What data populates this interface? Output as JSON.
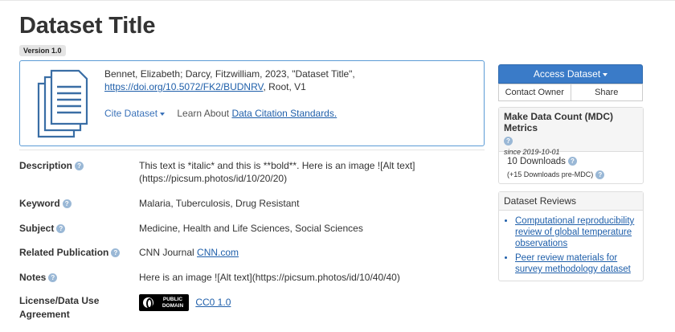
{
  "dataset": {
    "title": "Dataset Title",
    "version": "Version 1.0"
  },
  "citation": {
    "text": "Bennet, Elizabeth; Darcy, Fitzwilliam, 2023, \"Dataset Title\",",
    "doi": "https://doi.org/10.5072/FK2/BUDNRV",
    "suffix": ", Root, V1",
    "cite_label": "Cite Dataset",
    "learn_label": "Learn About",
    "standards_link": "Data Citation Standards."
  },
  "metadata": {
    "description_label": "Description",
    "description_value": "This text is *italic* and this is **bold**. Here is an image ![Alt text](https://picsum.photos/id/10/20/20)",
    "keyword_label": "Keyword",
    "keyword_value": "Malaria, Tuberculosis, Drug Resistant",
    "subject_label": "Subject",
    "subject_value": "Medicine, Health and Life Sciences, Social Sciences",
    "related_label": "Related Publication",
    "related_text": "CNN Journal",
    "related_link": "CNN.com",
    "notes_label": "Notes",
    "notes_value": "Here is an image ![Alt text](https://picsum.photos/id/10/40/40)",
    "license_label_1": "License/Data Use",
    "license_label_2": "Agreement",
    "license_badge_1": "PUBLIC",
    "license_badge_2": "DOMAIN",
    "license_link": "CC0 1.0"
  },
  "sidebar": {
    "access_label": "Access Dataset",
    "contact_label": "Contact Owner",
    "share_label": "Share",
    "mdc_title": "Make Data Count (MDC) Metrics",
    "mdc_since": "since 2019-10-01",
    "downloads": "10 Downloads",
    "downloads_pre": "(+15 Downloads pre-MDC)",
    "reviews_title": "Dataset Reviews",
    "review_1": "Computational reproducibility review of global temperature observations",
    "review_2": "Peer review materials for survey methodology dataset"
  },
  "help_glyph": "?",
  "colors": {
    "accent": "#3a7bc8",
    "link": "#1f5faa",
    "box_border": "#5b9bd5"
  },
  "icons": {
    "document": "document-stack-icon",
    "help": "help-circle-icon"
  }
}
